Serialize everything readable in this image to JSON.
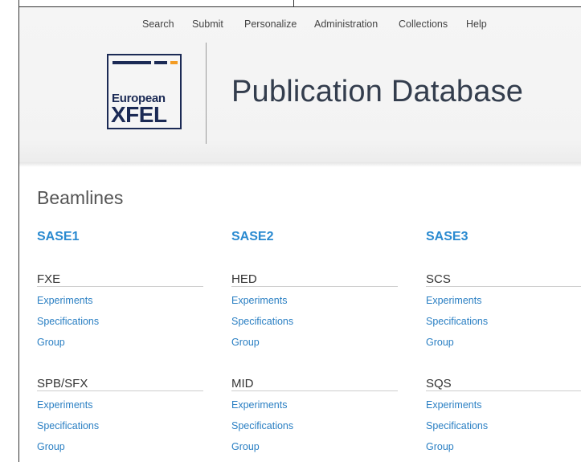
{
  "nav": {
    "items": [
      {
        "label": "Search"
      },
      {
        "label": "Submit"
      },
      {
        "label": "Personalize"
      },
      {
        "label": "Administration"
      },
      {
        "label": "Collections"
      },
      {
        "label": "Help"
      }
    ]
  },
  "logo": {
    "line1": "European",
    "line2": "XFEL",
    "colors": {
      "navy": "#1b2a55",
      "orange": "#f39c24"
    }
  },
  "site_title": "Publication Database",
  "section_title": "Beamlines",
  "colors": {
    "link": "#2a7fc3",
    "heading": "#2a8ad0"
  },
  "columns": [
    {
      "title": "SASE1",
      "instruments": [
        {
          "name": "FXE",
          "links": [
            "Experiments",
            "Specifications",
            "Group"
          ]
        },
        {
          "name": "SPB/SFX",
          "links": [
            "Experiments",
            "Specifications",
            "Group"
          ]
        }
      ]
    },
    {
      "title": "SASE2",
      "instruments": [
        {
          "name": "HED",
          "links": [
            "Experiments",
            "Specifications",
            "Group"
          ]
        },
        {
          "name": "MID",
          "links": [
            "Experiments",
            "Specifications",
            "Group"
          ]
        }
      ]
    },
    {
      "title": "SASE3",
      "instruments": [
        {
          "name": "SCS",
          "links": [
            "Experiments",
            "Specifications",
            "Group"
          ]
        },
        {
          "name": "SQS",
          "links": [
            "Experiments",
            "Specifications",
            "Group"
          ]
        }
      ]
    }
  ]
}
